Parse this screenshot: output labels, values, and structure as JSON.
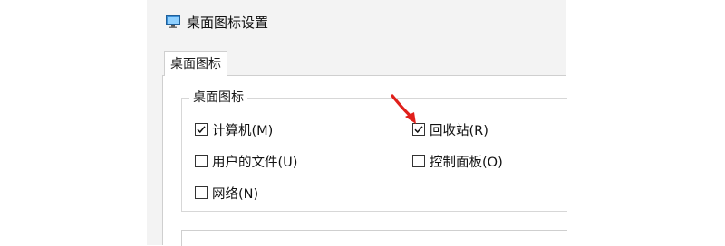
{
  "window": {
    "title": "桌面图标设置",
    "icon": "desktop-settings-icon"
  },
  "tabs": [
    {
      "label": "桌面图标",
      "selected": true
    }
  ],
  "group": {
    "legend": "桌面图标",
    "items": [
      {
        "label": "计算机(M)",
        "checked": true
      },
      {
        "label": "回收站(R)",
        "checked": true
      },
      {
        "label": "用户的文件(U)",
        "checked": false
      },
      {
        "label": "控制面板(O)",
        "checked": false
      },
      {
        "label": "网络(N)",
        "checked": false
      }
    ]
  },
  "annotation": {
    "color": "#e0201b",
    "icon": "red-arrow-icon"
  }
}
